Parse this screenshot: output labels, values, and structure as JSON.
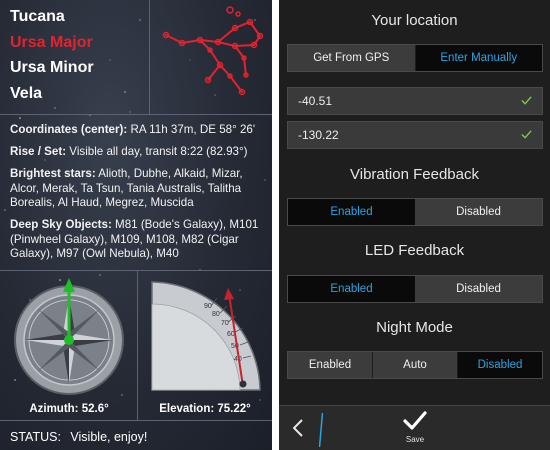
{
  "constellations": [
    "Tucana",
    "Ursa Major",
    "Ursa Minor",
    "Vela"
  ],
  "selected_constellation": "Ursa Major",
  "info": {
    "coordinates_label": "Coordinates (center):",
    "coordinates_value": "RA 11h 37m, DE 58° 26'",
    "rise_set_label": "Rise / Set:",
    "rise_set_value": "Visible all day, transit 8:22 (82.93°)",
    "brightest_label": "Brightest stars:",
    "brightest_value": "Alioth, Dubhe, Alkaid, Mizar, Alcor, Merak, Ta Tsun, Tania Australis, Talitha Borealis, Al Haud, Megrez, Muscida",
    "deep_sky_label": "Deep Sky Objects:",
    "deep_sky_value": "M81 (Bode's Galaxy), M101 (Pinwheel Galaxy), M109, M108, M82 (Cigar Galaxy), M97 (Owl Nebula), M40"
  },
  "azimuth": {
    "label": "Azimuth:",
    "value": "52.6°"
  },
  "elevation": {
    "label": "Elevation:",
    "value": "75.22°",
    "scale_ticks": [
      "90",
      "80",
      "70",
      "60",
      "50",
      "40"
    ]
  },
  "status": {
    "label": "STATUS:",
    "value": "Visible, enjoy!"
  },
  "settings": {
    "location": {
      "title": "Your location",
      "options": [
        "Get From GPS",
        "Enter Manually"
      ],
      "selected": "Enter Manually",
      "latitude": "-40.51",
      "longitude": "-130.22"
    },
    "vibration": {
      "title": "Vibration Feedback",
      "options": [
        "Enabled",
        "Disabled"
      ],
      "selected": "Enabled"
    },
    "led": {
      "title": "LED Feedback",
      "options": [
        "Enabled",
        "Disabled"
      ],
      "selected": "Enabled"
    },
    "night_mode": {
      "title": "Night Mode",
      "options": [
        "Enabled",
        "Auto",
        "Disabled"
      ],
      "selected": "Disabled"
    },
    "action_bar": {
      "save_label": "Save"
    }
  },
  "colors": {
    "accent_blue": "#2ba4e3",
    "selected_red": "#e2232f",
    "compass_green": "#1fbf2a"
  }
}
